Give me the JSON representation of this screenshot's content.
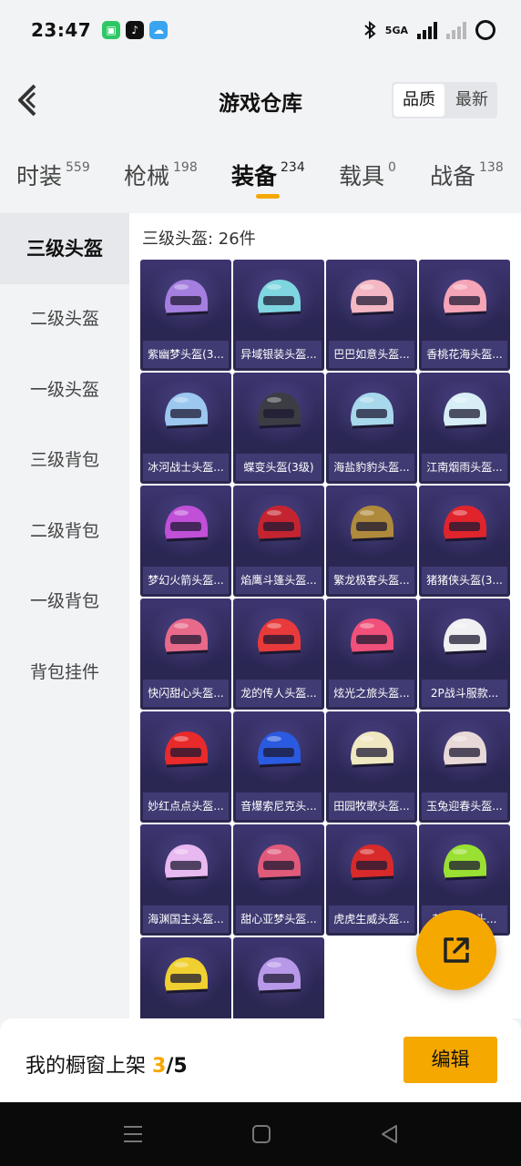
{
  "status_bar": {
    "time": "23:47",
    "network_label": "5GA",
    "app_icons": [
      "battery-saver-icon",
      "tiktok-icon",
      "weather-icon"
    ],
    "colors": {
      "green": "#2fc766",
      "black": "#111111",
      "blue": "#3aa4f0"
    }
  },
  "header": {
    "title": "游戏仓库",
    "sort_options": [
      {
        "label": "品质",
        "active": true
      },
      {
        "label": "最新",
        "active": false
      }
    ]
  },
  "tabs": [
    {
      "label": "时装",
      "count": "559"
    },
    {
      "label": "枪械",
      "count": "198"
    },
    {
      "label": "装备",
      "count": "234",
      "active": true
    },
    {
      "label": "载具",
      "count": "0"
    },
    {
      "label": "战备",
      "count": "138"
    }
  ],
  "sidebar": {
    "items": [
      {
        "label": "三级头盔",
        "active": true
      },
      {
        "label": "二级头盔"
      },
      {
        "label": "一级头盔"
      },
      {
        "label": "三级背包"
      },
      {
        "label": "二级背包"
      },
      {
        "label": "一级背包"
      },
      {
        "label": "背包挂件"
      }
    ]
  },
  "content": {
    "heading": "三级头盔: 26件",
    "items": [
      {
        "name": "紫幽梦头盔(3...",
        "color": "#a57fe0"
      },
      {
        "name": "异域银装头盔...",
        "color": "#7fd6e0"
      },
      {
        "name": "巴巴如意头盔...",
        "color": "#f3b8c4"
      },
      {
        "name": "香桃花海头盔...",
        "color": "#f6a5b6"
      },
      {
        "name": "冰河战士头盔...",
        "color": "#9cc8f0"
      },
      {
        "name": "蝶变头盔(3级)",
        "color": "#3c3c44"
      },
      {
        "name": "海盐豹豹头盔...",
        "color": "#a8d8ec"
      },
      {
        "name": "江南烟雨头盔...",
        "color": "#d8eef6"
      },
      {
        "name": "梦幻火箭头盔...",
        "color": "#c050d8"
      },
      {
        "name": "焰鹰斗篷头盔...",
        "color": "#c42430"
      },
      {
        "name": "繁龙极客头盔...",
        "color": "#b08a3c"
      },
      {
        "name": "猪猪侠头盔(3...",
        "color": "#e0242c"
      },
      {
        "name": "快闪甜心头盔...",
        "color": "#e86a8a"
      },
      {
        "name": "龙的传人头盔...",
        "color": "#e83a3a"
      },
      {
        "name": "炫光之旅头盔...",
        "color": "#f0507a"
      },
      {
        "name": "2P战斗服款...",
        "color": "#f0f0f2"
      },
      {
        "name": "妙红点点头盔...",
        "color": "#e82a2a"
      },
      {
        "name": "音爆索尼克头...",
        "color": "#2a5ae0"
      },
      {
        "name": "田园牧歌头盔...",
        "color": "#f0e8c0"
      },
      {
        "name": "玉兔迎春头盔...",
        "color": "#e8d8d8"
      },
      {
        "name": "海渊国主头盔...",
        "color": "#e8b8f0"
      },
      {
        "name": "甜心亚梦头盔...",
        "color": "#e05a7a"
      },
      {
        "name": "虎虎生威头盔...",
        "color": "#d82a2a"
      },
      {
        "name": "萌趣...子头...",
        "color": "#9ae032"
      },
      {
        "name": "",
        "color": "#f0d030"
      },
      {
        "name": "",
        "color": "#b898e8"
      }
    ]
  },
  "bottom_bar": {
    "label": "我的橱窗上架",
    "count": "3",
    "total": "/5",
    "edit_label": "编辑"
  },
  "accent_color": "#f5a800"
}
